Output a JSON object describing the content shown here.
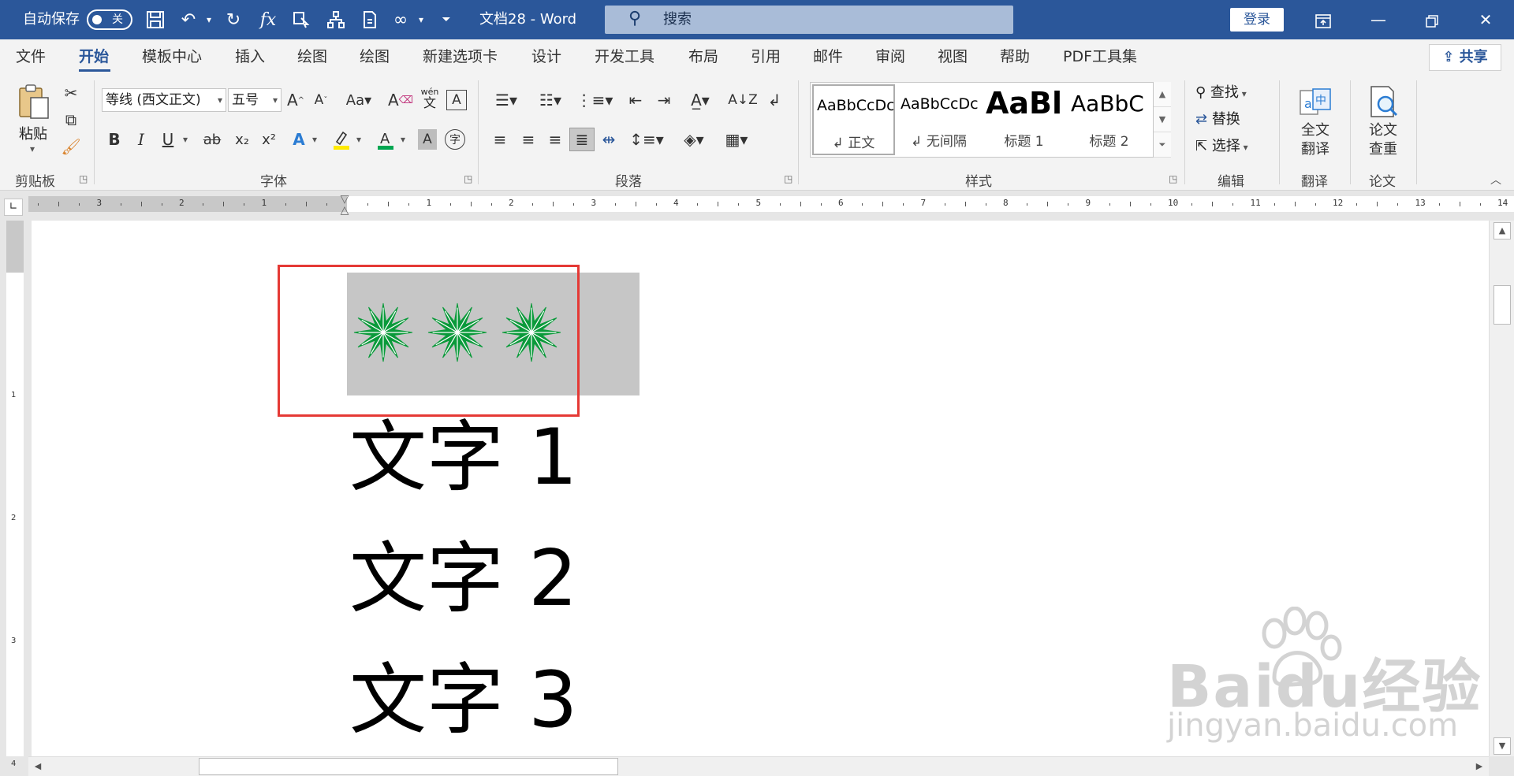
{
  "titlebar": {
    "autosave_label": "自动保存",
    "autosave_state": "关",
    "doc_title": "文档28  -  Word",
    "search_placeholder": "搜索",
    "login_label": "登录",
    "icons": [
      "save-icon",
      "undo-icon",
      "redo-icon",
      "formula-icon",
      "touch-mode-icon",
      "hierarchy-icon",
      "document-icon",
      "infinity-icon",
      "customize-qat-icon"
    ],
    "accent": "#2b579a"
  },
  "tabs": [
    "文件",
    "开始",
    "模板中心",
    "插入",
    "绘图",
    "绘图",
    "新建选项卡",
    "设计",
    "开发工具",
    "布局",
    "引用",
    "邮件",
    "审阅",
    "视图",
    "帮助",
    "PDF工具集"
  ],
  "active_tab": "开始",
  "share_label": "共享",
  "clipboard": {
    "paste_label": "粘贴",
    "group_label": "剪贴板"
  },
  "font": {
    "font_name": "等线 (西文正文)",
    "font_size": "五号",
    "group_label": "字体",
    "phonetic_top": "wén",
    "phonetic_bottom": "文",
    "format_buttons": [
      "B",
      "I",
      "U",
      "ab",
      "x₂",
      "x²"
    ]
  },
  "paragraph": {
    "group_label": "段落"
  },
  "styles": {
    "group_label": "样式",
    "items": [
      {
        "sample": "AaBbCcDc",
        "name": "↲ 正文"
      },
      {
        "sample": "AaBbCcDc",
        "name": "↲ 无间隔"
      },
      {
        "sample": "AaBl",
        "name": "标题 1"
      },
      {
        "sample": "AaBbC",
        "name": "标题 2"
      }
    ]
  },
  "editing": {
    "find": "查找",
    "replace": "替换",
    "select": "选择",
    "group_label": "编辑"
  },
  "translate": {
    "label_line1": "全文",
    "label_line2": "翻译",
    "group_label": "翻译"
  },
  "paper": {
    "label_line1": "论文",
    "label_line2": "查重",
    "group_label": "论文"
  },
  "ruler": {
    "numbers": [
      "3",
      "2",
      "1",
      "1",
      "2",
      "3",
      "4",
      "5",
      "6",
      "7",
      "8",
      "9",
      "10",
      "11",
      "12",
      "13",
      "14"
    ]
  },
  "vruler": {
    "numbers": [
      "1",
      "2",
      "3",
      "4"
    ]
  },
  "document": {
    "image_description_icons": [
      "star-icon",
      "star-icon",
      "star-icon"
    ],
    "lines": [
      "文字 1",
      "文字 2",
      "文字 3"
    ],
    "star_color": "#0a9a3a",
    "selection_color": "#e53935"
  },
  "watermark": {
    "brand": "Baidu经验",
    "url": "jingyan.baidu.com"
  }
}
